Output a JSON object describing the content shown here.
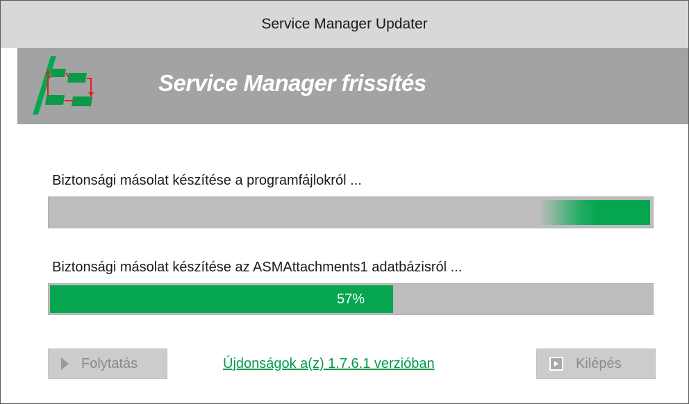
{
  "window": {
    "title": "Service Manager Updater"
  },
  "banner": {
    "title": "Service Manager frissítés",
    "logo_icon": "workflow-logo-icon"
  },
  "steps": [
    {
      "label": "Biztonsági másolat készítése a programfájlokról ...",
      "progress_mode": "marquee"
    },
    {
      "label": "Biztonsági másolat készítése az ASMAttachments1 adatbázisról ...",
      "progress_percent": 57,
      "progress_text": "57%"
    }
  ],
  "footer": {
    "continue_label": "Folytatás",
    "continue_icon": "play-icon",
    "link_text": "Újdonságok a(z) 1.7.6.1 verzióban",
    "exit_label": "Kilépés",
    "exit_icon": "exit-icon"
  },
  "colors": {
    "accent_green": "#06a651",
    "banner_bg": "#a3a3a3",
    "titlebar_bg": "#d8d8d8",
    "progress_track": "#bdbdbd",
    "link_green": "#009a4e",
    "disabled_button": "#cccccc"
  }
}
